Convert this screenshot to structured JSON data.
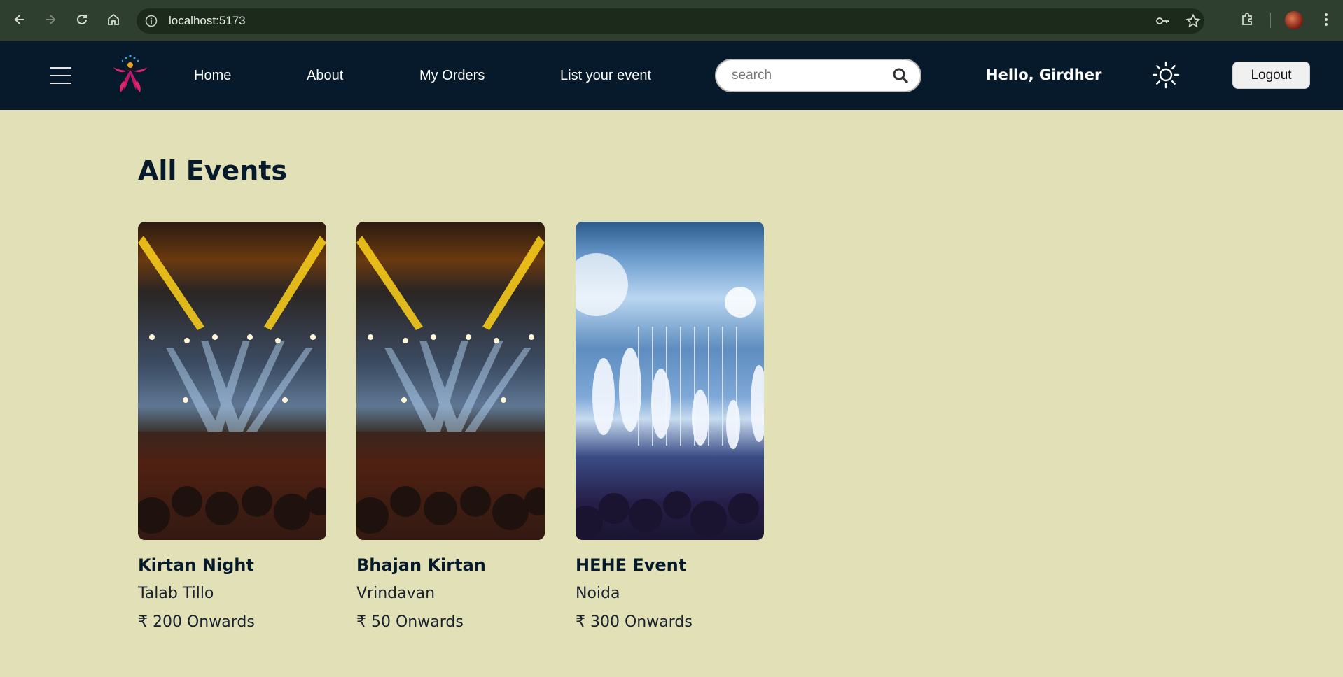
{
  "browser": {
    "url": "localhost:5173"
  },
  "nav": {
    "links": [
      "Home",
      "About",
      "My Orders",
      "List your event"
    ],
    "search_placeholder": "search",
    "greeting": "Hello, Girdher",
    "logout_label": "Logout"
  },
  "page": {
    "heading": "All Events"
  },
  "events": [
    {
      "title": "Kirtan Night",
      "location": "Talab Tillo",
      "price": "₹ 200 Onwards"
    },
    {
      "title": "Bhajan Kirtan",
      "location": "Vrindavan",
      "price": "₹ 50 Onwards"
    },
    {
      "title": "HEHE Event",
      "location": "Noida",
      "price": "₹ 300 Onwards"
    }
  ],
  "colors": {
    "page_bg": "#e1e0b6",
    "nav_bg": "#061a2c",
    "heading": "#061a2c"
  }
}
